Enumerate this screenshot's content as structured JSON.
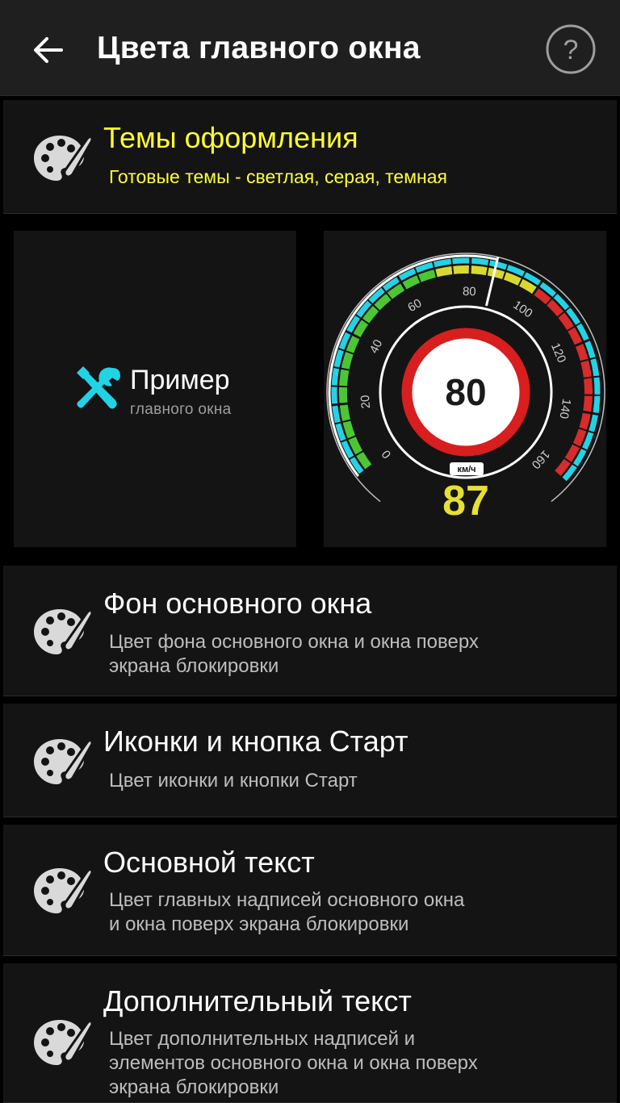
{
  "appbar": {
    "title": "Цвета главного окна",
    "back_icon": "arrow-left-icon",
    "help_icon": "question-circle-icon",
    "help_glyph": "?"
  },
  "themes": {
    "title": "Темы оформления",
    "subtitle": "Готовые темы - светлая, серая, темная",
    "icon": "palette-icon",
    "accent": "#ffff33"
  },
  "preview": {
    "example_title": "Пример",
    "example_subtitle": "главного окна",
    "tools_icon": "wrench-screwdriver-icon",
    "tools_color": "#22d3e6",
    "gauge": {
      "ticks": [
        "0",
        "20",
        "40",
        "60",
        "80",
        "100",
        "120",
        "140",
        "160"
      ],
      "speed_limit": "80",
      "unit": "км/ч",
      "current_speed": "87",
      "speed_color": "#e6e033",
      "sign_color": "#d81e1e"
    }
  },
  "settings": [
    {
      "title": "Фон основного окна",
      "subtitle_lines": [
        "Цвет фона основного окна и окна поверх",
        "экрана блокировки"
      ]
    },
    {
      "title": "Иконки и кнопка Старт",
      "subtitle_lines": [
        "Цвет иконки и кнопки Старт"
      ]
    },
    {
      "title": "Основной текст",
      "subtitle_lines": [
        "Цвет главных надписей основного окна",
        "и окна поверх экрана блокировки"
      ]
    },
    {
      "title": "Дополнительный текст",
      "subtitle_lines": [
        "Цвет дополнительных надписей и",
        "элементов основного окна и окна поверх",
        "экрана блокировки"
      ]
    }
  ]
}
